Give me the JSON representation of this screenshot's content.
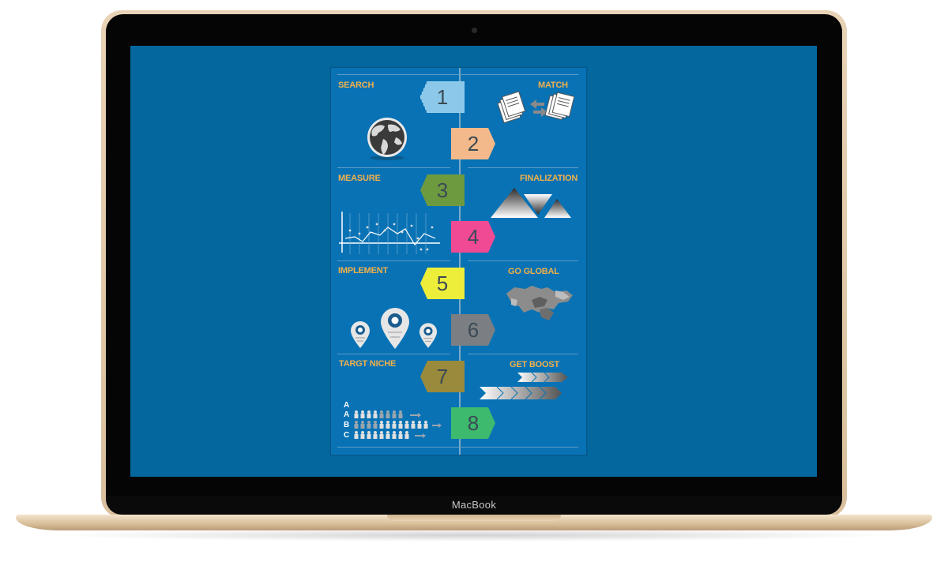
{
  "device": {
    "brand_label": "MacBook"
  },
  "infographic": {
    "steps": [
      {
        "number": "1",
        "label": "SEARCH",
        "color": "#8cc8ea"
      },
      {
        "number": "2",
        "label": "MATCH",
        "color": "#f3b98a"
      },
      {
        "number": "3",
        "label": "MEASURE",
        "color": "#6e9a3f"
      },
      {
        "number": "4",
        "label": "FINALIZATION",
        "color": "#ef4a93"
      },
      {
        "number": "5",
        "label": "IMPLEMENT",
        "color": "#ecee3a"
      },
      {
        "number": "6",
        "label": "GO GLOBAL",
        "color": "#7b7f83"
      },
      {
        "number": "7",
        "label": "TARGT NICHE",
        "color": "#9a8a3c"
      },
      {
        "number": "8",
        "label": "GET BOOST",
        "color": "#3dba6d"
      }
    ],
    "niche_rows": [
      "A",
      "A",
      "B",
      "C"
    ]
  },
  "colors": {
    "screen_bg": "#04689f",
    "poster_bg": "#0872b5",
    "label": "#f2b14a"
  }
}
